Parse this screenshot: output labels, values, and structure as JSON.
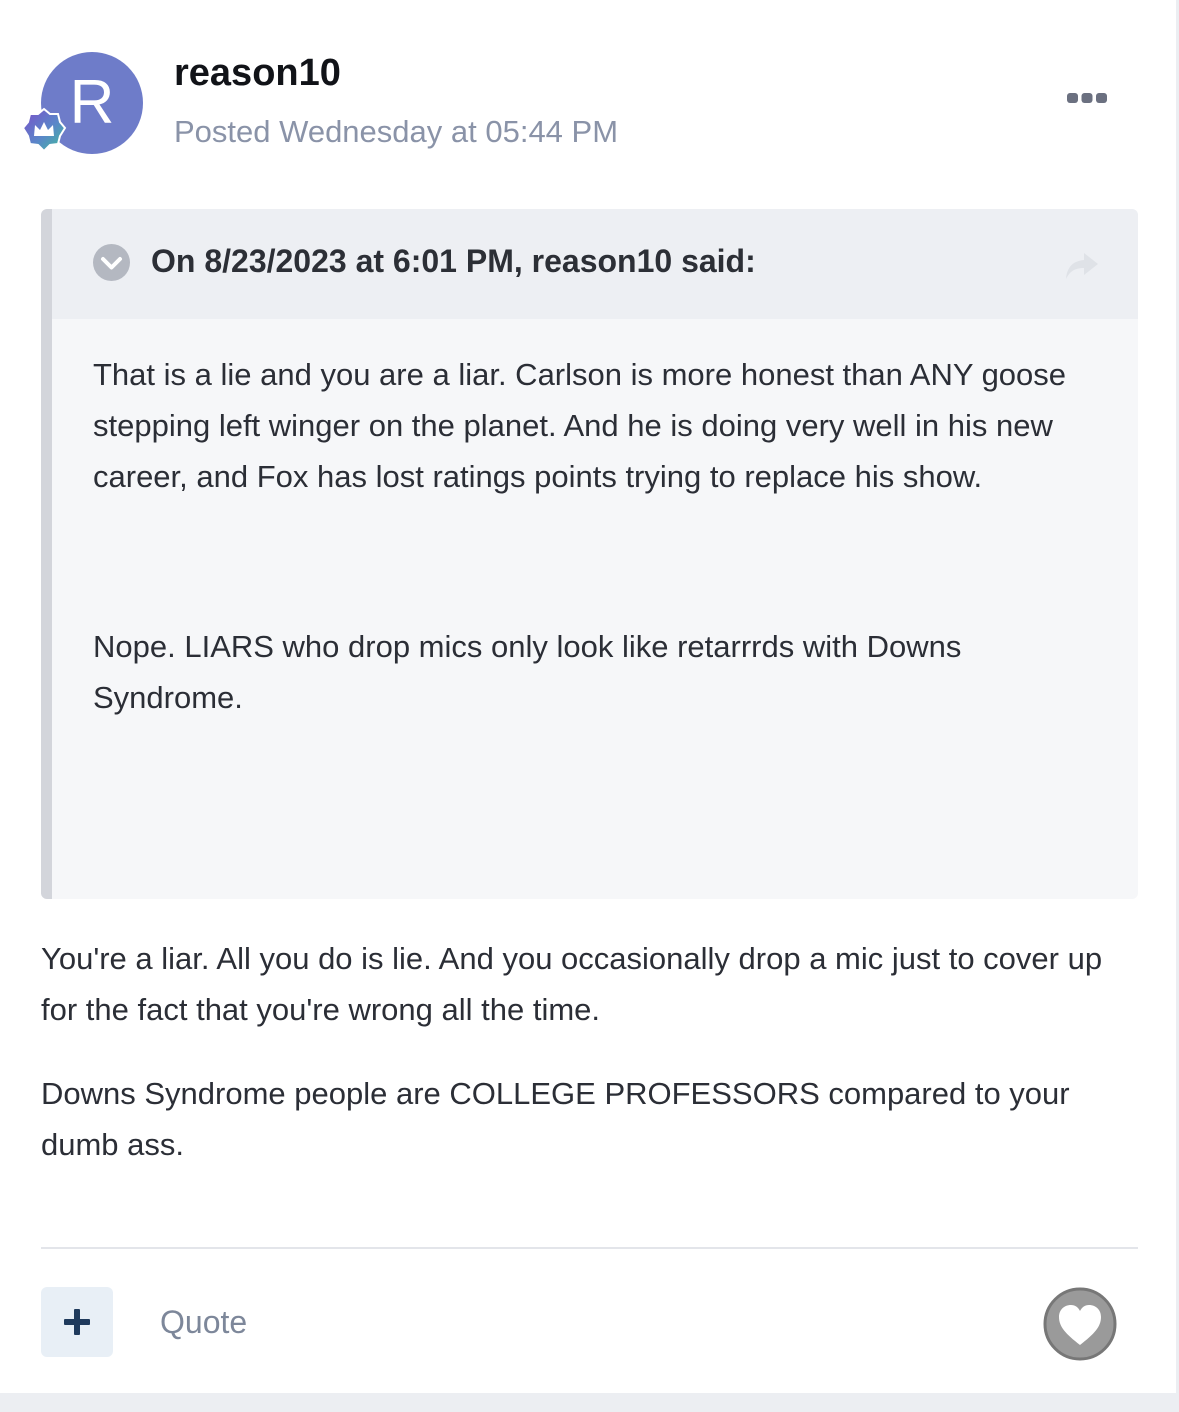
{
  "post": {
    "author": "reason10",
    "avatar_letter": "R",
    "posted_label": "Posted Wednesday at 05:44 PM",
    "avatar_color": "#6e7cc9",
    "more_icon": "ellipsis-icon"
  },
  "quote": {
    "citation": "On 8/23/2023 at 6:01 PM, reason10 said:",
    "paragraphs": [
      "That is a lie and you are a liar. Carlson is more honest than ANY goose stepping left winger on the planet. And he is doing very well in his new career, and Fox has lost ratings points trying to replace his show.",
      "Nope. LIARS who  drop mics only look like retarrrds with Downs Syndrome."
    ],
    "toggle_icon": "chevron-down-icon",
    "share_icon": "share-arrow-icon"
  },
  "body": {
    "paragraphs": [
      "You're a liar. All you do is lie. And you occasionally drop a mic just to cover up for the fact that you're wrong all the time.",
      "Downs Syndrome  people are COLLEGE PROFESSORS compared to your dumb ass."
    ]
  },
  "footer": {
    "add_icon": "plus-icon",
    "quote_label": "Quote",
    "react_icon": "heart-icon"
  }
}
